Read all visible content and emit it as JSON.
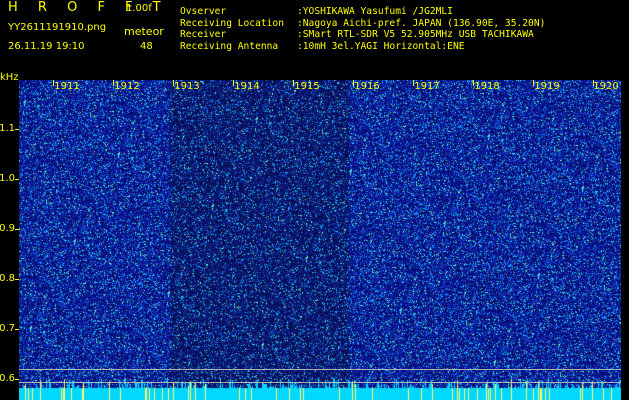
{
  "header": {
    "brand": "H R O F F T",
    "version": "1.00f",
    "filename": "YY2611191910.png",
    "datetime": "26.11.19 19:10",
    "meteor_label": "meteor",
    "meteor_count": "48"
  },
  "info": {
    "observer_label": "Ovserver",
    "observer_value": ":YOSHIKAWA Yasufumi /JG2MLI",
    "location_label": "Receiving Location",
    "location_value": ":Nagoya Aichi-pref. JAPAN (136.90E, 35.20N)",
    "receiver_label": "Receiver",
    "receiver_value": ":SMart RTL-SDR V5 52.905MHz USB TACHIKAWA",
    "antenna_label": "Receiving Antenna",
    "antenna_value": ":10mH 3el.YAGI Horizontal:ENE"
  },
  "axis": {
    "y_unit": "kHz",
    "y_ticks": [
      "1.1",
      "1.0",
      "0.9",
      "0.8",
      "0.7",
      "0.6"
    ],
    "x_ticks": [
      "1911",
      "1912",
      "1913",
      "1914",
      "1915",
      "1916",
      "1917",
      "1918",
      "1919",
      "1920"
    ]
  },
  "colors": {
    "background": "#000000",
    "text": "#ffff00",
    "waterfall_base": "#0a1a9a",
    "noise_floor": "#00d8ff"
  }
}
